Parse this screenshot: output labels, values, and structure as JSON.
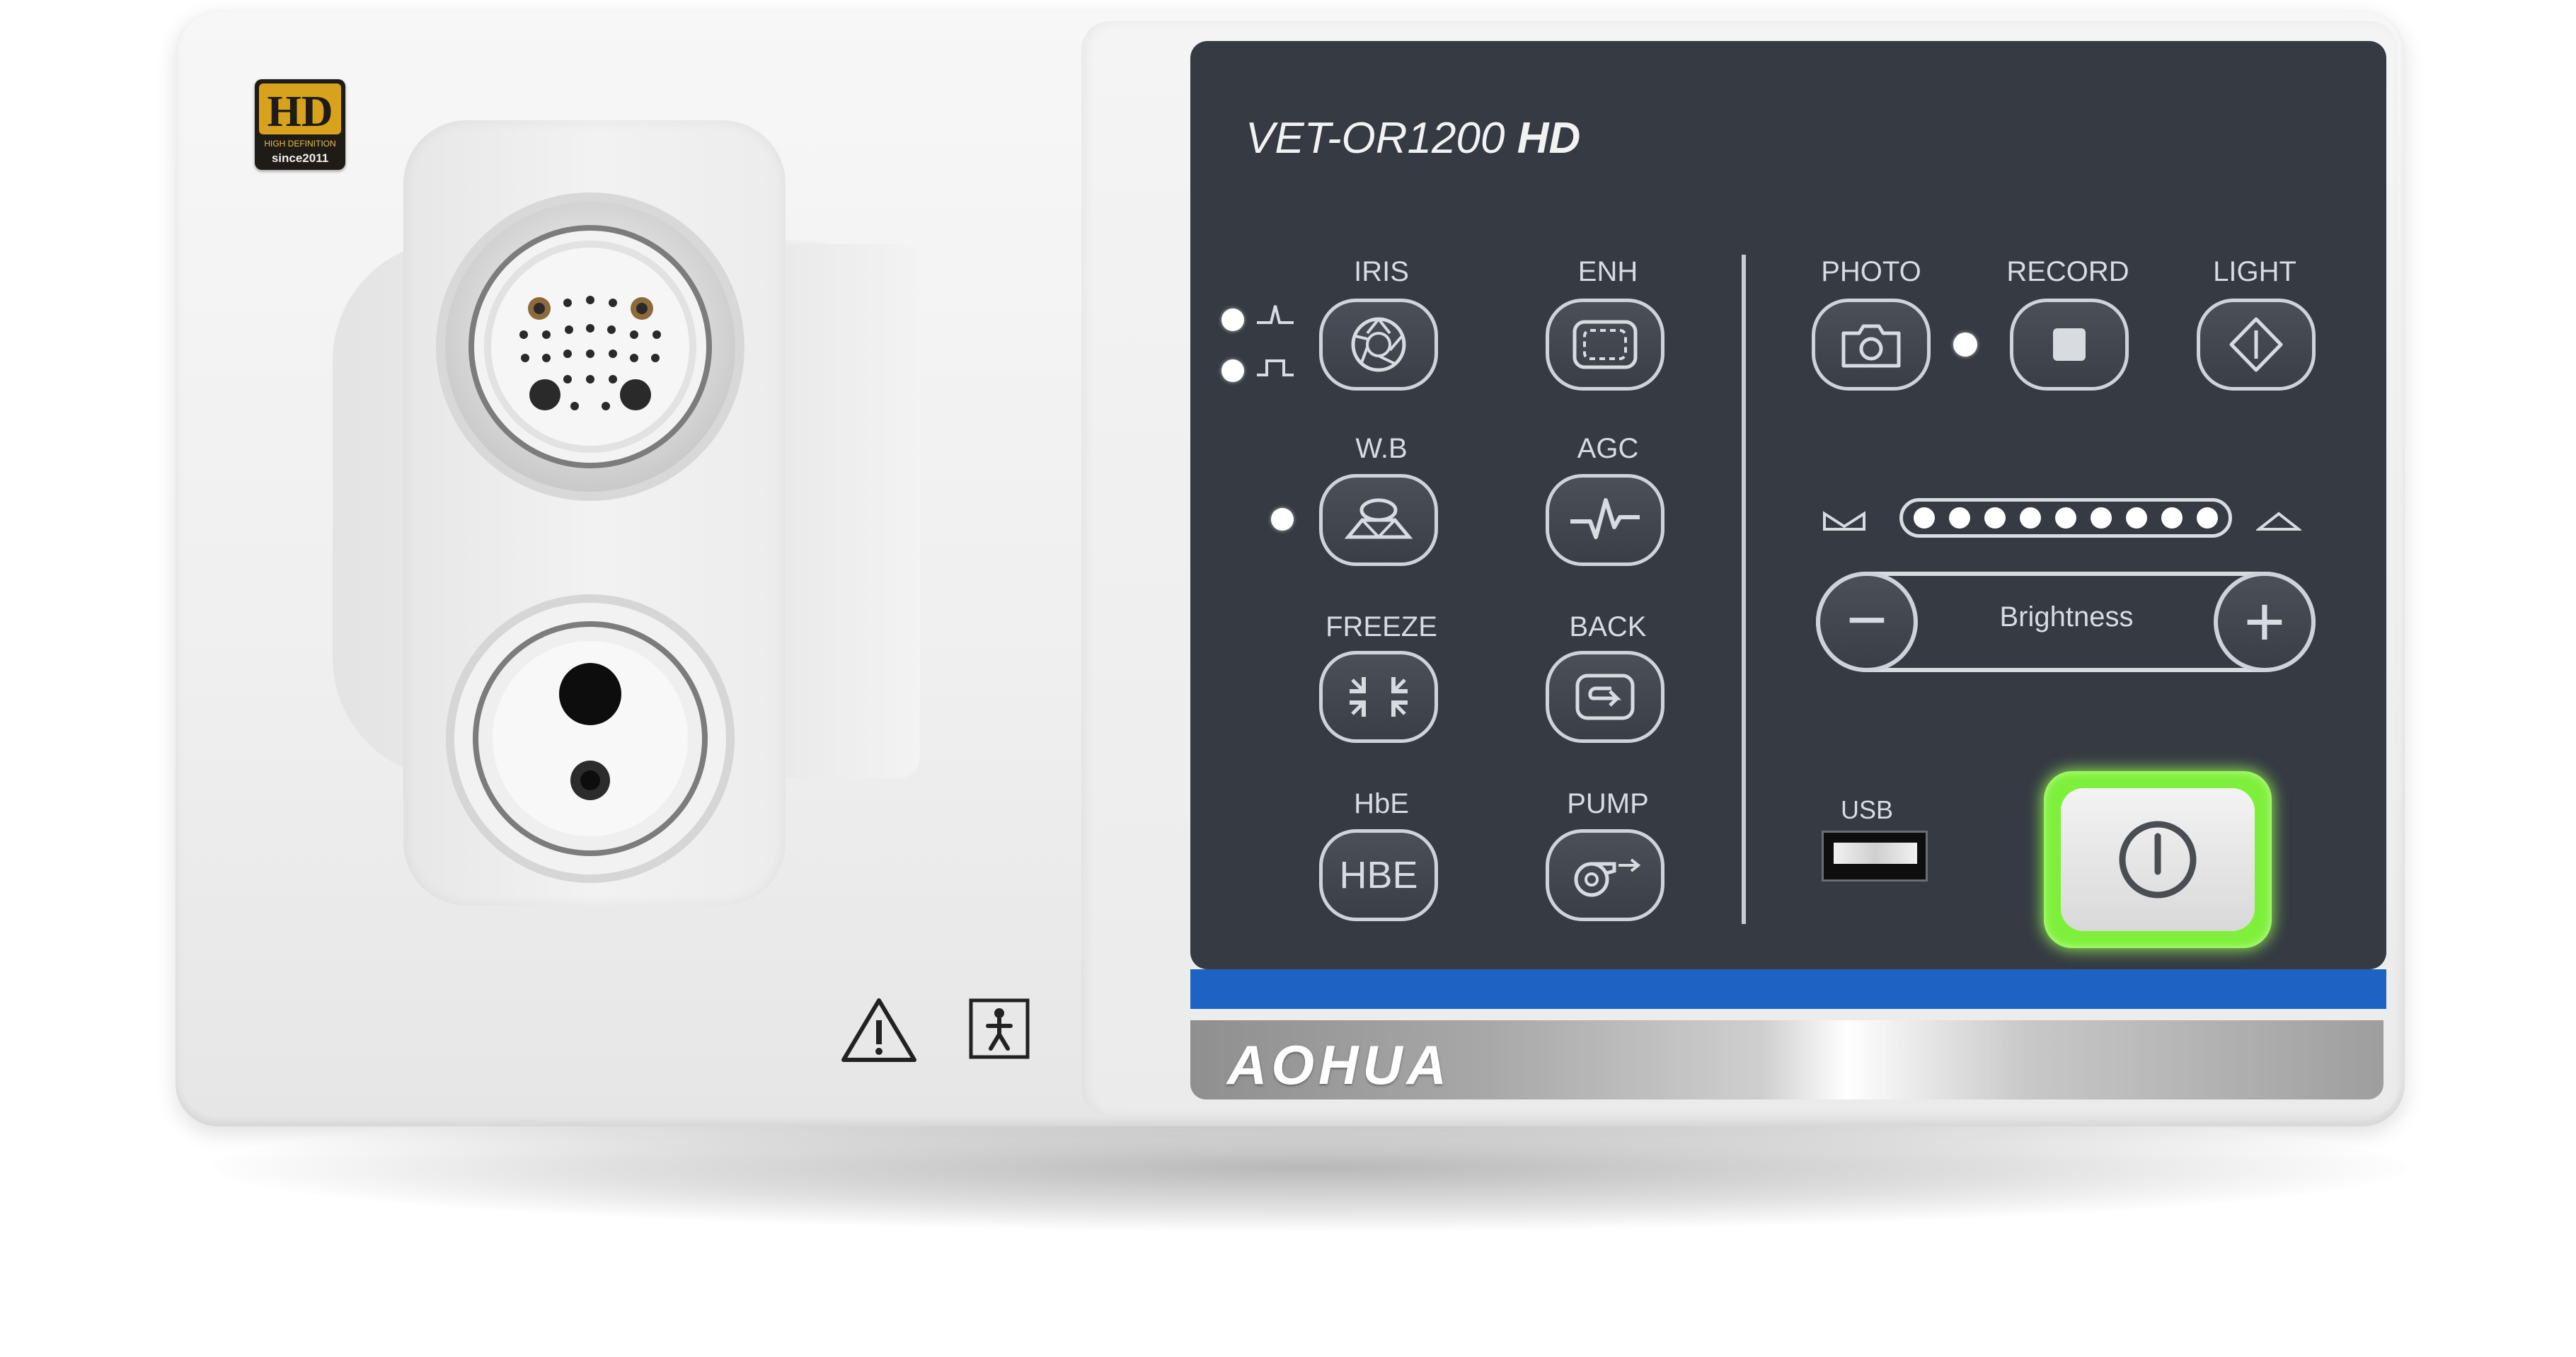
{
  "model": {
    "name": "VET-OR1200",
    "suffix": "HD"
  },
  "hd_logo": {
    "top": "HD",
    "middle": "HIGH DEFINITION",
    "bottom": "since2011"
  },
  "left_controls": [
    {
      "id": "iris",
      "label": "IRIS",
      "icon": "aperture-icon"
    },
    {
      "id": "enh",
      "label": "ENH",
      "icon": "enhance-frame-icon"
    },
    {
      "id": "wb",
      "label": "W.B",
      "icon": "white-balance-icon"
    },
    {
      "id": "agc",
      "label": "AGC",
      "icon": "waveform-icon"
    },
    {
      "id": "freeze",
      "label": "FREEZE",
      "icon": "collapse-arrows-icon"
    },
    {
      "id": "back",
      "label": "BACK",
      "icon": "return-icon"
    },
    {
      "id": "hbe",
      "label": "HbE",
      "button_text": "HBE"
    },
    {
      "id": "pump",
      "label": "PUMP",
      "icon": "pump-icon"
    }
  ],
  "right_controls": [
    {
      "id": "photo",
      "label": "PHOTO",
      "icon": "camera-icon"
    },
    {
      "id": "record",
      "label": "RECORD",
      "icon": "stop-square-icon"
    },
    {
      "id": "light",
      "label": "LIGHT",
      "icon": "diamond-icon"
    }
  ],
  "brightness": {
    "label": "Brightness",
    "level": 9,
    "max_level": 9,
    "minus_symbol": "−",
    "plus_symbol": "+"
  },
  "usb": {
    "label": "USB"
  },
  "power": {
    "icon": "power-icon",
    "ring_color": "#7ef03c"
  },
  "brand": {
    "name": "AOHUA"
  },
  "colors": {
    "panel": "#353a43",
    "strip": "#1e63c4",
    "power_glow": "#7ef03c"
  }
}
